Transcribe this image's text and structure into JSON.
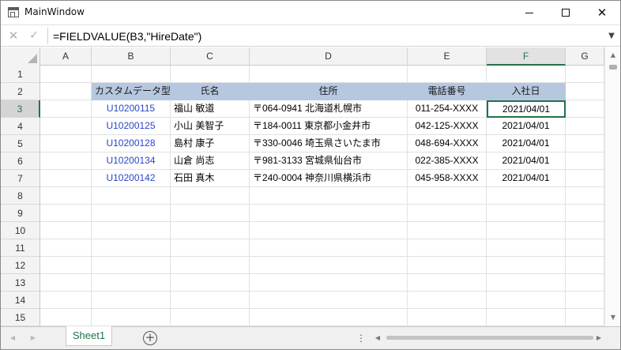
{
  "window": {
    "title": "MainWindow"
  },
  "formula_bar": {
    "cancel_icon": "✕",
    "confirm_icon": "✓",
    "formula": "=FIELDVALUE(B3,\"HireDate\")",
    "dropdown_icon": "chevron-down-icon"
  },
  "columns": [
    "A",
    "B",
    "C",
    "D",
    "E",
    "F",
    "G"
  ],
  "selected_column": "F",
  "selected_row": "3",
  "row_numbers": [
    "1",
    "2",
    "3",
    "4",
    "5",
    "6",
    "7",
    "8",
    "9",
    "10",
    "11",
    "12",
    "13",
    "14",
    "15"
  ],
  "table": {
    "headers": [
      "カスタムデータ型",
      "氏名",
      "住所",
      "電話番号",
      "入社日"
    ],
    "rows": [
      {
        "code": "U10200115",
        "name": "福山 敏道",
        "address": "〒064-0941 北海道札幌市",
        "phone": "011-254-XXXX",
        "hire_date": "2021/04/01"
      },
      {
        "code": "U10200125",
        "name": "小山 美智子",
        "address": "〒184-0011 東京都小金井市",
        "phone": "042-125-XXXX",
        "hire_date": "2021/04/01"
      },
      {
        "code": "U10200128",
        "name": "島村 康子",
        "address": "〒330-0046 埼玉県さいたま市",
        "phone": "048-694-XXXX",
        "hire_date": "2021/04/01"
      },
      {
        "code": "U10200134",
        "name": "山倉 尚志",
        "address": "〒981-3133 宮城県仙台市",
        "phone": "022-385-XXXX",
        "hire_date": "2021/04/01"
      },
      {
        "code": "U10200142",
        "name": "石田 真木",
        "address": "〒240-0004 神奈川県横浜市",
        "phone": "045-958-XXXX",
        "hire_date": "2021/04/01"
      }
    ]
  },
  "tabs": {
    "sheet1": "Sheet1"
  },
  "colors": {
    "accent": "#217346",
    "header_fill": "#b6c7e0",
    "code_text": "#2a45c8"
  }
}
